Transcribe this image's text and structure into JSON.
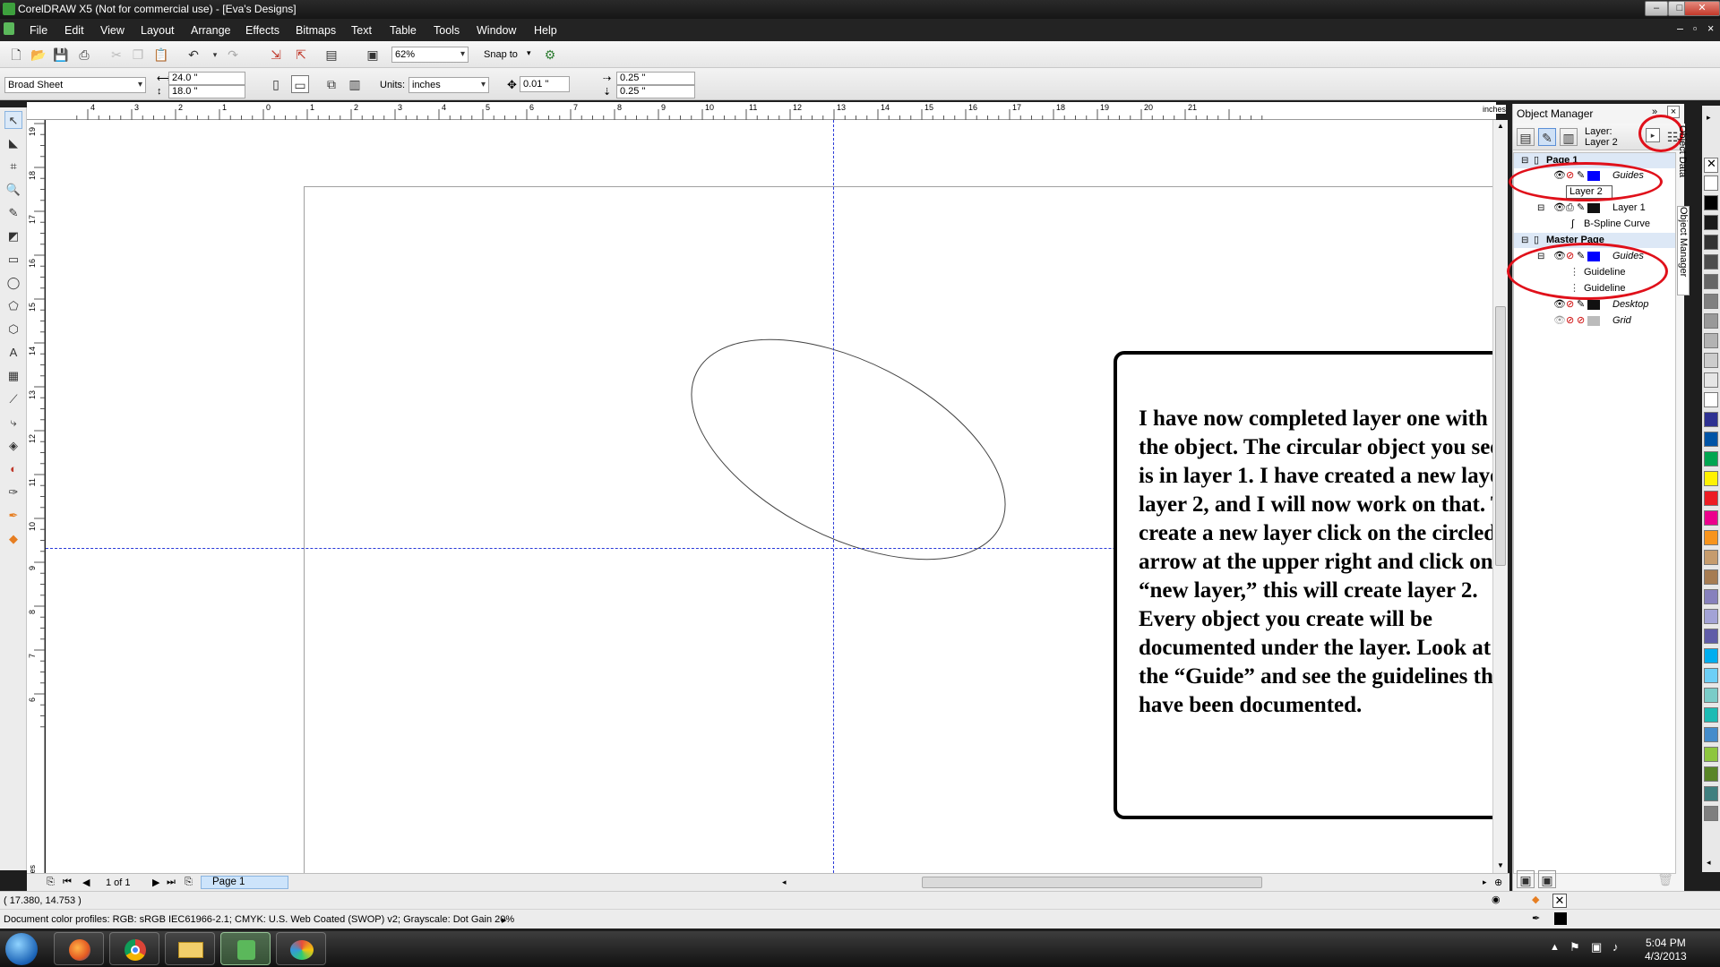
{
  "window": {
    "title": "CorelDRAW X5 (Not for commercial use) - [Eva's Designs]",
    "controls": [
      "–",
      "□",
      "✕"
    ]
  },
  "menu": [
    "File",
    "Edit",
    "View",
    "Layout",
    "Arrange",
    "Effects",
    "Bitmaps",
    "Text",
    "Table",
    "Tools",
    "Window",
    "Help"
  ],
  "standard_toolbar": {
    "zoom": "62%",
    "snap_to": "Snap to"
  },
  "property_bar": {
    "paper_preset": "Broad Sheet",
    "width": "24.0 \"",
    "height": "18.0 \"",
    "units_label": "Units:",
    "units": "inches",
    "nudge": "0.01 \"",
    "dup_x": "0.25 \"",
    "dup_y": "0.25 \""
  },
  "rulers": {
    "h_ticks": [
      "4",
      "3",
      "2",
      "1",
      "0",
      "1",
      "2",
      "3",
      "4",
      "5",
      "6",
      "7",
      "8",
      "9",
      "10",
      "11",
      "12",
      "13",
      "14",
      "15",
      "16",
      "17",
      "18",
      "19",
      "20",
      "21"
    ],
    "h_unit": "inches",
    "v_ticks": [
      "19",
      "18",
      "17",
      "16",
      "15",
      "14",
      "13",
      "12",
      "11",
      "10",
      "9",
      "8",
      "7",
      "6"
    ],
    "v_unit": "inches"
  },
  "callout": {
    "text": "I have now completed layer one with the object. The circular object you see is in layer 1. I have created a new layer, layer 2, and I will now work on that. To create a new layer click on the circled arrow at the upper right and click on “new layer,” this will create layer 2.  Every object you create will be documented under the layer. Look at the “Guide” and see the guidelines that have been documented."
  },
  "page_nav": {
    "counter": "1 of 1",
    "tab": "Page 1"
  },
  "object_manager": {
    "title": "Object Manager",
    "layer_label": "Layer:",
    "layer_name": "Layer 2",
    "tree": {
      "page1": "Page 1",
      "guides": "Guides",
      "layer2_edit": "Layer 2",
      "layer1": "Layer 1",
      "curve": "B-Spline Curve",
      "master": "Master Page",
      "master_guides": "Guides",
      "guideline1": "Guideline",
      "guideline2": "Guideline",
      "desktop": "Desktop",
      "grid": "Grid"
    },
    "side_tabs": [
      "Object Data",
      "Object Manager"
    ]
  },
  "palette": {
    "colors": [
      "#ffffff",
      "#000000",
      "#1a1a1a",
      "#333333",
      "#4d4d4d",
      "#666666",
      "#808080",
      "#999999",
      "#b3b3b3",
      "#cccccc",
      "#e6e6e6",
      "#ffffff",
      "#2e3192",
      "#0054a6",
      "#00a651",
      "#fff200",
      "#ed1c24",
      "#ec008c",
      "#f7941d",
      "#c69c6d",
      "#a67c52",
      "#8781bd",
      "#a3a3d6",
      "#605ca8",
      "#00aeef",
      "#6dcff6",
      "#7accc8",
      "#1cbbb4",
      "#448ccb",
      "#8dc63f",
      "#598527",
      "#3f7f7f",
      "#7f7f7f"
    ]
  },
  "status": {
    "coords": "( 17.380, 14.753 )",
    "profiles": "Document color profiles: RGB: sRGB IEC61966-2.1; CMYK: U.S. Web Coated (SWOP) v2; Grayscale: Dot Gain 20%"
  },
  "taskbar": {
    "time": "5:04 PM",
    "date": "4/3/2013"
  }
}
